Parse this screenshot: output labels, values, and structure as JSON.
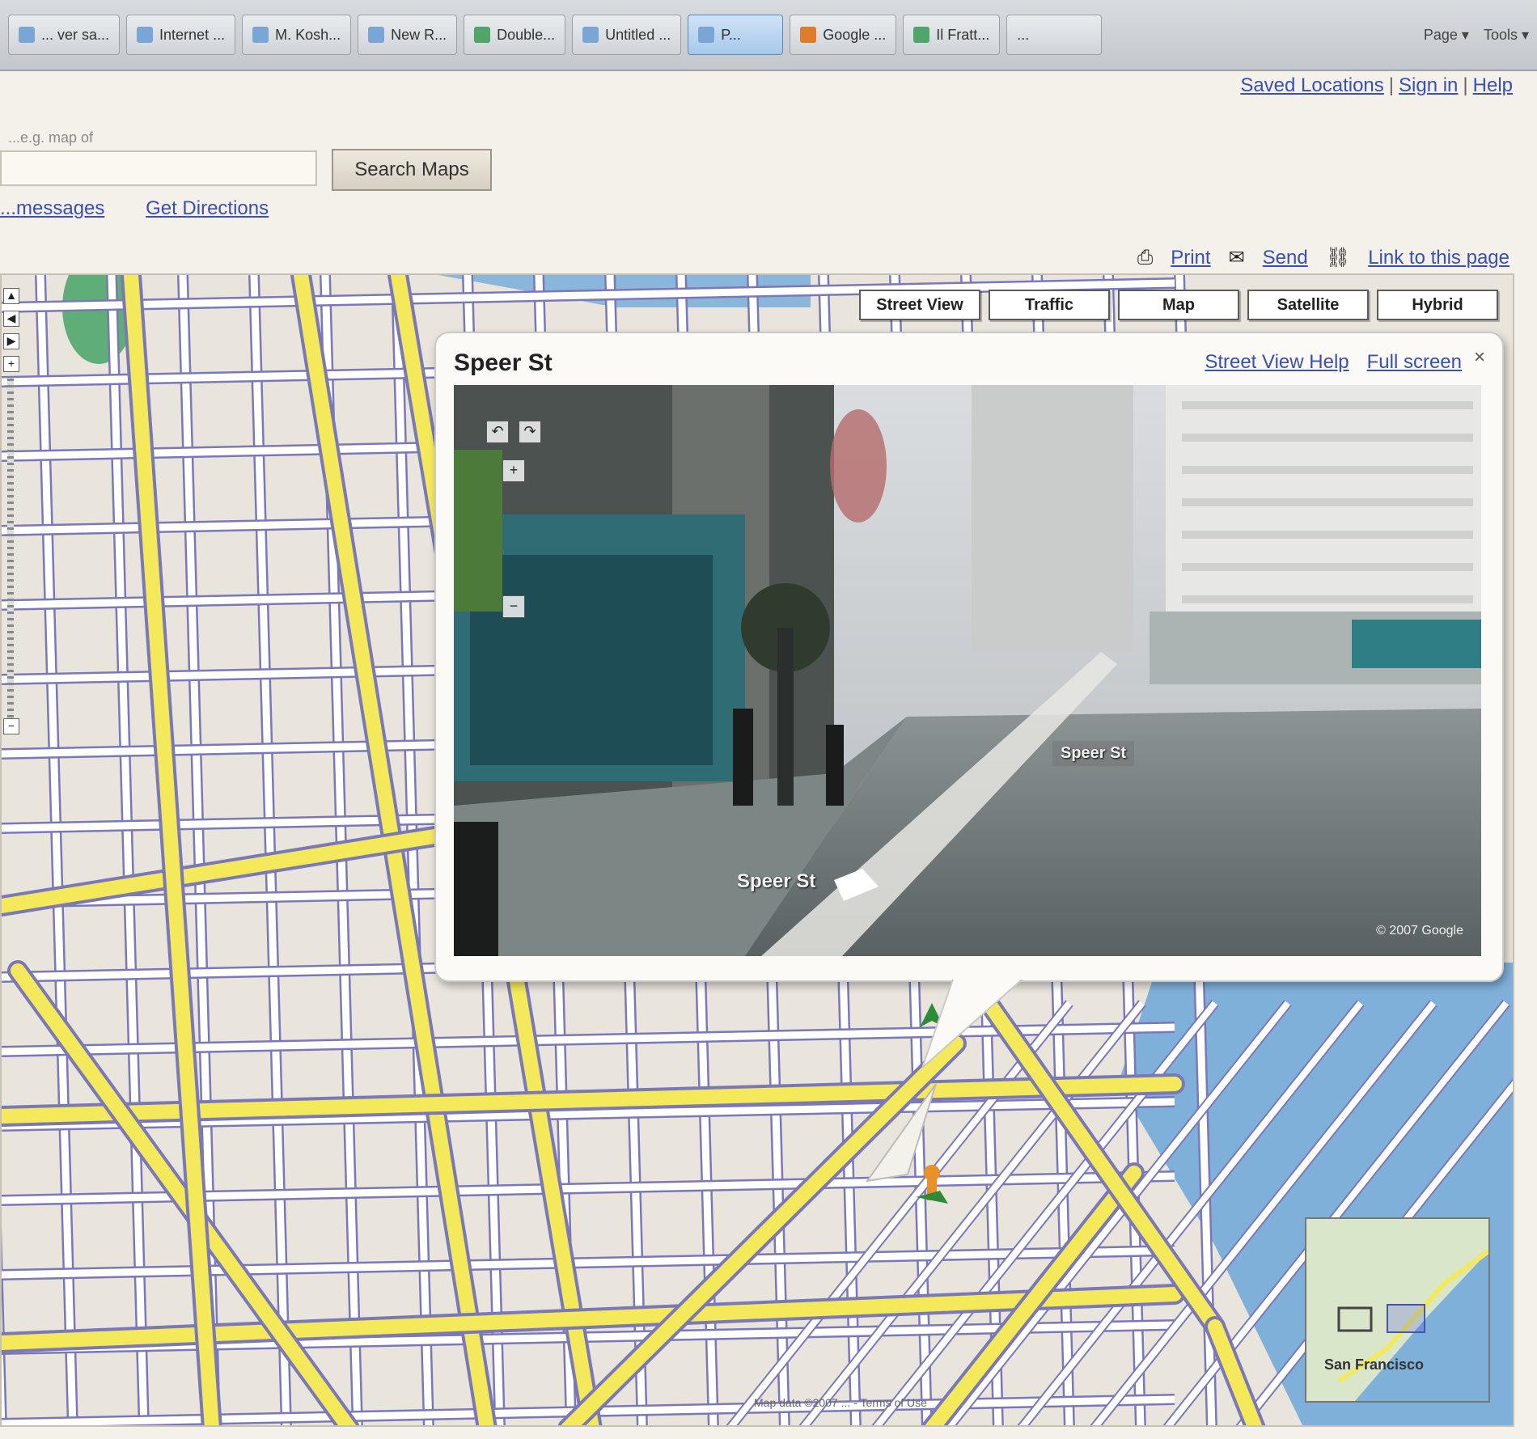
{
  "taskbar": {
    "tabs": [
      {
        "label": "... ver sa..."
      },
      {
        "label": "Internet ..."
      },
      {
        "label": "M. Kosh..."
      },
      {
        "label": "New R..."
      },
      {
        "label": "Double..."
      },
      {
        "label": "Untitled ..."
      },
      {
        "label": "P..."
      },
      {
        "label": "Google ..."
      },
      {
        "label": "Il Fratt..."
      },
      {
        "label": "..."
      }
    ],
    "tray": [
      "Page ▾",
      "Tools ▾"
    ]
  },
  "top_links": [
    "Saved Locations",
    "Sign in",
    "Help"
  ],
  "search": {
    "hint": "...e.g. map of",
    "value": "",
    "button_label": "Search Maps"
  },
  "sub_links": [
    "...messages",
    "Get Directions"
  ],
  "map_links": [
    "Print",
    "Send",
    "Link to this page"
  ],
  "map_types": [
    "Street View",
    "Traffic",
    "Map",
    "Satellite",
    "Hybrid"
  ],
  "street_view": {
    "title": "Speer St",
    "subtitle": "",
    "links": [
      "Street View Help",
      "Full screen"
    ],
    "close_label": "×",
    "street_label": "Speer St",
    "street_label_far": "Speer St",
    "copyright": "© 2007 Google"
  },
  "overview_label": "San Francisco",
  "map_copyright": "Map data ©2007 ... - Terms of Use",
  "colors": {
    "road_major": "#f4e95a",
    "road_minor": "#ffffff",
    "road_outline": "#7a78b8",
    "water": "#7fb0d9",
    "land": "#e9e5dc",
    "link": "#3a4fb0"
  }
}
